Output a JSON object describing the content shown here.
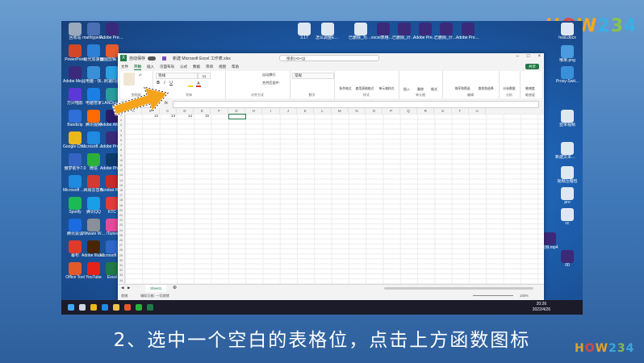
{
  "brand": {
    "text": "HOW234",
    "colors": [
      "#f4a81d",
      "#e6463a",
      "#f4a81d",
      "#39b0e5",
      "#8bc34a",
      "#39b0e5"
    ]
  },
  "subtitle": "2、选中一个空白的表格位，点击上方函数图标",
  "desktop": {
    "left_icons": [
      {
        "label": "回收站",
        "color": "#9aa9bb"
      },
      {
        "label": "mathtype6...",
        "color": "#4a6fb5"
      },
      {
        "label": "Adobe Premiere...",
        "color": "#3b2a79"
      },
      {
        "label": "PowerPoint",
        "color": "#d24726"
      },
      {
        "label": "极光加速器",
        "color": "#2d7fd8"
      },
      {
        "label": "图图剪辑电脑版",
        "color": "#e45b2e"
      },
      {
        "label": "Adobe Media...",
        "color": "#3b2a79"
      },
      {
        "label": "此电脑 - 快捷方式",
        "color": "#3a8fd9"
      },
      {
        "label": "照速同盘",
        "color": "#2aa1e2"
      },
      {
        "label": "万兴喵影",
        "color": "#5b39d6"
      },
      {
        "label": "电脑管家",
        "color": "#1a80e5"
      },
      {
        "label": "LANDrop...",
        "color": "#2b9c9c"
      },
      {
        "label": "Bandizip",
        "color": "#2e6fd8"
      },
      {
        "label": "腾讯视频",
        "color": "#ff6a00"
      },
      {
        "label": "Adobe After Effects 2022",
        "color": "#2b1b66"
      },
      {
        "label": "Google Chrome",
        "color": "#e8b81c"
      },
      {
        "label": "Microsoft Edge",
        "color": "#1e8be0"
      },
      {
        "label": "Adobe Premiere",
        "color": "#3b2a79"
      },
      {
        "label": "傲梦助手7.0",
        "color": "#3563c4"
      },
      {
        "label": "微信",
        "color": "#2bb13a"
      },
      {
        "label": "Adobe Photosh...",
        "color": "#0e3b6b"
      },
      {
        "label": "Microsoft Edge",
        "color": "#1e8be0"
      },
      {
        "label": "网易云音乐",
        "color": "#d33a31"
      },
      {
        "label": "Acrobat Reader",
        "color": "#c62b2b"
      },
      {
        "label": "Spotify",
        "color": "#1db954"
      },
      {
        "label": "腾讯QQ",
        "color": "#1a9ee6"
      },
      {
        "label": "KTC",
        "color": "#e23b3b"
      },
      {
        "label": "腾讯会议",
        "color": "#1c6be0"
      },
      {
        "label": "VMware Workstat...",
        "color": "#8a8f99"
      },
      {
        "label": "iTunes",
        "color": "#e64a9a"
      },
      {
        "label": "幕布",
        "color": "#e03a2a"
      },
      {
        "label": "Adobe Illustrat...",
        "color": "#4a2600"
      },
      {
        "label": "Microsoft E5 Renew",
        "color": "#2e69c9"
      },
      {
        "label": "Office Tool",
        "color": "#e35a2a"
      },
      {
        "label": "YouTube",
        "color": "#e62117"
      },
      {
        "label": "Excel",
        "color": "#1f7a45"
      }
    ],
    "top_icons": [
      {
        "label": "3.17",
        "color": "#dfe7f2"
      },
      {
        "label": "怎么调整Excel表格大...",
        "color": "#dfe7f2"
      },
      {
        "label": "已删除_为什么word文...",
        "color": "#dfe7f2"
      },
      {
        "label": "excel表格图片跟随...",
        "color": "#3b2a79"
      },
      {
        "label": "已删除_计算机二级...",
        "color": "#3b2a79"
      },
      {
        "label": "Adobe Premier...",
        "color": "#3b2a79"
      },
      {
        "label": "已删除_计算机二级...",
        "color": "#3b2a79"
      },
      {
        "label": "Adobe Premier...",
        "color": "#3b2a79"
      }
    ],
    "right_icons": [
      {
        "label": "host.docx",
        "color": "#dfe7f2"
      },
      {
        "label": "哪果.png",
        "color": "#4a9be0"
      },
      {
        "label": "Proxy-Swit...",
        "color": "#3a8fd9"
      },
      {
        "label": "亚米视频",
        "color": "#dfe7f2"
      },
      {
        "label": "新建文本文档.txt",
        "color": "#dfe7f2"
      },
      {
        "label": "视频压缩包",
        "color": "#dfe7f2"
      },
      {
        "label": "pro",
        "color": "#dfe7f2"
      },
      {
        "label": "cc",
        "color": "#dfe7f2"
      },
      {
        "label": "视频.mp4",
        "color": "#3b2a79"
      },
      {
        "label": "00",
        "color": "#3b2a79"
      }
    ]
  },
  "excel": {
    "autosave_label": "自动保存",
    "title": "新建 Microsoft Excel 工作表.xlsx",
    "search_placeholder": "搜索(Alt+Q)",
    "tabs": [
      "文件",
      "开始",
      "插入",
      "页面布局",
      "公式",
      "数据",
      "审阅",
      "视图",
      "帮助"
    ],
    "active_tab": "开始",
    "share_label": "共享",
    "ribbon_groups": [
      {
        "label": "剪贴板"
      },
      {
        "label": "字体"
      },
      {
        "label": "对齐方式"
      },
      {
        "label": "数字"
      },
      {
        "label": "样式"
      },
      {
        "label": "单元格"
      },
      {
        "label": "编辑"
      },
      {
        "label": "分析"
      },
      {
        "label": "敏感度"
      }
    ],
    "ribbon_buttons": {
      "font_name": "等线",
      "font_size": "11",
      "wrap_text": "自动换行",
      "merge_center": "合并后居中",
      "number_format": "常规",
      "conditional_format": "条件格式",
      "table_format": "套用表格格式",
      "cell_styles": "单元格样式",
      "insert": "插入",
      "delete": "删除",
      "format": "格式",
      "sort_filter": "排序和筛选",
      "find_select": "查找和选择",
      "analyze": "分析数据",
      "sensitivity": "敏感度"
    },
    "fx_label": "fx",
    "columns": [
      "A",
      "B",
      "C",
      "D",
      "E",
      "F",
      "G",
      "H",
      "I",
      "J",
      "K",
      "L",
      "M",
      "N",
      "O",
      "P",
      "Q",
      "R",
      "S",
      "T",
      "U"
    ],
    "rows": [
      "1",
      "2",
      "3",
      "4",
      "5",
      "6",
      "7",
      "8",
      "9",
      "10",
      "11",
      "12",
      "13",
      "14",
      "15",
      "16",
      "17",
      "18",
      "19",
      "20",
      "21",
      "22",
      "23",
      "24",
      "25",
      "26",
      "27",
      "28",
      "29",
      "30",
      "31",
      "32",
      "33",
      "34"
    ],
    "cell_values": [
      "12",
      "13",
      "14",
      "15"
    ],
    "sheet_tab": "Sheet1",
    "status_left": "就绪",
    "status_accessibility": "辅助功能: 一切就绪",
    "zoom": "100%"
  },
  "taskbar": {
    "time": "20:26",
    "date": "2022/4/26",
    "icons": [
      {
        "name": "windows",
        "color": "#3fa9f5"
      },
      {
        "name": "search",
        "color": "#cfd6df"
      },
      {
        "name": "chrome",
        "color": "#e8b81c"
      },
      {
        "name": "edge",
        "color": "#1e8be0"
      },
      {
        "name": "explorer",
        "color": "#f1c24a"
      },
      {
        "name": "app",
        "color": "#e35a2a"
      },
      {
        "name": "wechat",
        "color": "#2bb13a"
      },
      {
        "name": "excel",
        "color": "#1f7a45"
      }
    ]
  }
}
